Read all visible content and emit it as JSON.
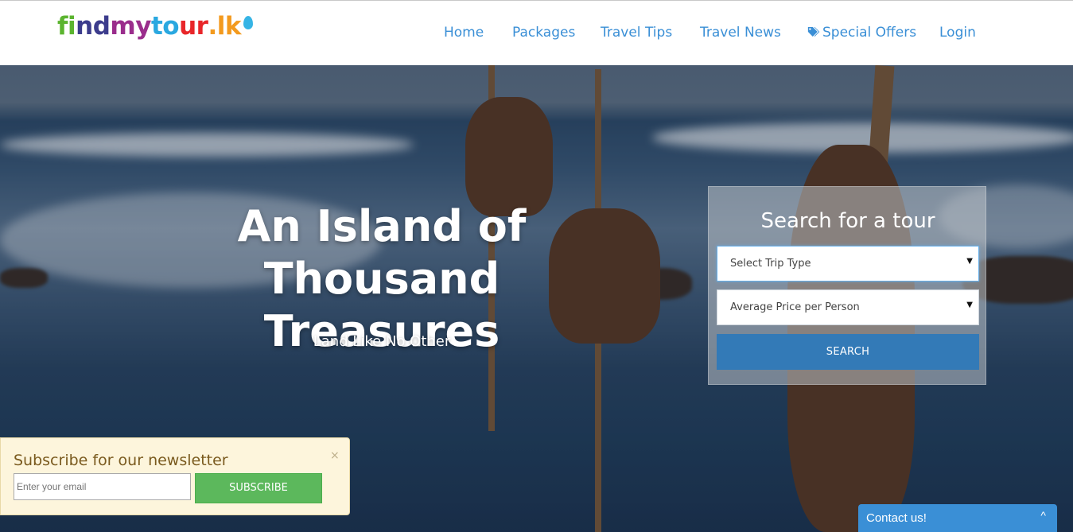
{
  "brand": {
    "logo_letters": [
      {
        "ch": "f",
        "color": "#5bb42f"
      },
      {
        "ch": "i",
        "color": "#5bb42f"
      },
      {
        "ch": "n",
        "color": "#3c3c8c"
      },
      {
        "ch": "d",
        "color": "#3c3c8c"
      },
      {
        "ch": "m",
        "color": "#9a2d8c"
      },
      {
        "ch": "y",
        "color": "#9a2d8c"
      },
      {
        "ch": "t",
        "color": "#2aa8e0"
      },
      {
        "ch": "o",
        "color": "#2aa8e0"
      },
      {
        "ch": "u",
        "color": "#e8262a"
      },
      {
        "ch": "r",
        "color": "#e8262a"
      },
      {
        "ch": ".",
        "color": "#f39a1e"
      },
      {
        "ch": "l",
        "color": "#f39a1e"
      },
      {
        "ch": "k",
        "color": "#f39a1e"
      }
    ],
    "drop_icon": "water-drop-icon"
  },
  "nav": {
    "items": [
      {
        "label": "Home"
      },
      {
        "label": "Packages"
      },
      {
        "label": "Travel Tips"
      },
      {
        "label": "Travel News"
      },
      {
        "label": "Special Offers",
        "icon": "tags-icon"
      },
      {
        "label": "Login"
      }
    ],
    "color": "#3a8fd6"
  },
  "hero": {
    "title_line1": "An Island of Thousand",
    "title_line2": "Treasures",
    "subtitle": "Land Like No Other"
  },
  "search": {
    "title": "Search for a tour",
    "trip_type": {
      "value": "Select Trip Type"
    },
    "price": {
      "value": "Average Price per Person"
    },
    "button_label": "SEARCH",
    "button_color": "#337ab7"
  },
  "newsletter": {
    "title": "Subscribe for our newsletter",
    "close_label": "×",
    "email_placeholder": "Enter your email",
    "button_label": "SUBSCRIBE",
    "button_color": "#5cb85c"
  },
  "contact": {
    "label": "Contact us!",
    "chevron": "^"
  }
}
